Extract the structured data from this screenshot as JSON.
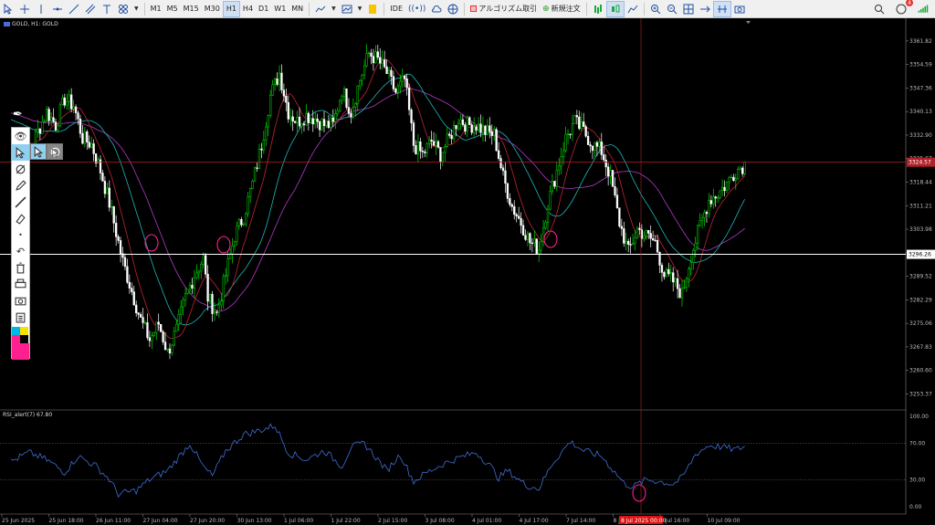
{
  "toolbar": {
    "timeframes": [
      "M1",
      "M5",
      "M15",
      "M30",
      "H1",
      "H4",
      "D1",
      "W1",
      "MN"
    ],
    "active_timeframe": "H1",
    "ide_label": "IDE",
    "algo_label": "アルゴリズム取引",
    "new_order_label": "新規注文",
    "notification_count": "4"
  },
  "chart": {
    "symbol_label": "GOLD, H1:  GOLD",
    "rsi_label": "RSI_alert(7) 67.80",
    "current_price_label": "3324.57",
    "horizontal_line_label": "3296.26",
    "cursor_time_label": "8 Jul 2025 00:00",
    "price_ticks": [
      "3361.82",
      "3354.59",
      "3347.36",
      "3340.13",
      "3332.90",
      "3325.67",
      "3318.44",
      "3311.21",
      "3303.98",
      "3296.75",
      "3289.52",
      "3282.29",
      "3275.06",
      "3267.83",
      "3260.60",
      "3253.37"
    ],
    "rsi_ticks": [
      "100.00",
      "70.00",
      "30.00",
      "0.00"
    ],
    "time_ticks": [
      "25 Jun 2025",
      "25 Jun 18:00",
      "26 Jun 11:00",
      "27 Jun 04:00",
      "27 Jun 20:00",
      "30 Jun 13:00",
      "1 Jul 06:00",
      "1 Jul 22:00",
      "2 Jul 15:00",
      "3 Jul 08:00",
      "4 Jul 01:00",
      "4 Jul 17:00",
      "7 Jul 14:00",
      "8 Jul",
      "9 Jul 16:00",
      "10 Jul 09:00"
    ],
    "colors": {
      "bull": "#00e000",
      "bear": "#ffffff",
      "ma_fast": "#c0262f",
      "ma_mid": "#1fb8b8",
      "ma_slow": "#b23bc7",
      "rsi": "#3f6fd6",
      "annotation": "#ff1f8f"
    }
  },
  "chart_data": {
    "type": "candlestick",
    "y_range": [
      3249,
      3366
    ],
    "close_path": [
      [
        0,
        3330
      ],
      [
        4,
        3333
      ],
      [
        8,
        3328
      ],
      [
        12,
        3334
      ],
      [
        16,
        3340
      ],
      [
        20,
        3336
      ],
      [
        24,
        3344
      ],
      [
        28,
        3342
      ],
      [
        32,
        3332
      ],
      [
        36,
        3330
      ],
      [
        40,
        3322
      ],
      [
        44,
        3312
      ],
      [
        48,
        3300
      ],
      [
        50,
        3294
      ],
      [
        54,
        3285
      ],
      [
        58,
        3276
      ],
      [
        62,
        3270
      ],
      [
        66,
        3275
      ],
      [
        70,
        3266
      ],
      [
        74,
        3273
      ],
      [
        78,
        3283
      ],
      [
        82,
        3290
      ],
      [
        86,
        3295
      ],
      [
        88,
        3283
      ],
      [
        92,
        3278
      ],
      [
        96,
        3290
      ],
      [
        100,
        3302
      ],
      [
        104,
        3308
      ],
      [
        108,
        3318
      ],
      [
        112,
        3330
      ],
      [
        116,
        3345
      ],
      [
        120,
        3352
      ],
      [
        124,
        3340
      ],
      [
        128,
        3337
      ],
      [
        132,
        3339
      ],
      [
        136,
        3338
      ],
      [
        140,
        3336
      ],
      [
        144,
        3336
      ],
      [
        148,
        3347
      ],
      [
        152,
        3340
      ],
      [
        156,
        3350
      ],
      [
        160,
        3358
      ],
      [
        164,
        3356
      ],
      [
        168,
        3352
      ],
      [
        172,
        3346
      ],
      [
        176,
        3350
      ],
      [
        180,
        3330
      ],
      [
        184,
        3327
      ],
      [
        188,
        3331
      ],
      [
        192,
        3327
      ],
      [
        196,
        3332
      ],
      [
        200,
        3338
      ],
      [
        204,
        3336
      ],
      [
        208,
        3336
      ],
      [
        212,
        3334
      ],
      [
        216,
        3333
      ],
      [
        220,
        3320
      ],
      [
        224,
        3311
      ],
      [
        228,
        3306
      ],
      [
        232,
        3300
      ],
      [
        236,
        3298
      ],
      [
        240,
        3312
      ],
      [
        244,
        3322
      ],
      [
        248,
        3332
      ],
      [
        252,
        3337
      ],
      [
        256,
        3334
      ],
      [
        260,
        3330
      ],
      [
        264,
        3328
      ],
      [
        268,
        3320
      ],
      [
        272,
        3306
      ],
      [
        276,
        3297
      ],
      [
        280,
        3304
      ],
      [
        284,
        3302
      ],
      [
        288,
        3300
      ],
      [
        292,
        3290
      ],
      [
        296,
        3288
      ],
      [
        300,
        3284
      ],
      [
        304,
        3296
      ],
      [
        308,
        3305
      ],
      [
        312,
        3313
      ],
      [
        316,
        3315
      ],
      [
        320,
        3318
      ],
      [
        324,
        3322
      ],
      [
        328,
        3324
      ]
    ],
    "rsi_path": [
      [
        0,
        50
      ],
      [
        8,
        60
      ],
      [
        16,
        52
      ],
      [
        24,
        38
      ],
      [
        30,
        56
      ],
      [
        38,
        45
      ],
      [
        44,
        30
      ],
      [
        48,
        14
      ],
      [
        56,
        18
      ],
      [
        62,
        30
      ],
      [
        70,
        40
      ],
      [
        76,
        58
      ],
      [
        80,
        70
      ],
      [
        86,
        44
      ],
      [
        90,
        34
      ],
      [
        96,
        62
      ],
      [
        104,
        80
      ],
      [
        112,
        85
      ],
      [
        118,
        90
      ],
      [
        124,
        60
      ],
      [
        132,
        52
      ],
      [
        140,
        62
      ],
      [
        148,
        45
      ],
      [
        152,
        66
      ],
      [
        158,
        70
      ],
      [
        164,
        52
      ],
      [
        168,
        40
      ],
      [
        174,
        58
      ],
      [
        180,
        28
      ],
      [
        186,
        38
      ],
      [
        192,
        46
      ],
      [
        200,
        54
      ],
      [
        208,
        60
      ],
      [
        214,
        46
      ],
      [
        218,
        32
      ],
      [
        222,
        40
      ],
      [
        230,
        24
      ],
      [
        236,
        20
      ],
      [
        242,
        48
      ],
      [
        250,
        72
      ],
      [
        256,
        62
      ],
      [
        264,
        56
      ],
      [
        270,
        38
      ],
      [
        274,
        26
      ],
      [
        278,
        22
      ],
      [
        284,
        30
      ],
      [
        290,
        28
      ],
      [
        296,
        25
      ],
      [
        300,
        32
      ],
      [
        306,
        58
      ],
      [
        312,
        68
      ],
      [
        318,
        66
      ],
      [
        324,
        63
      ],
      [
        328,
        67
      ]
    ]
  }
}
